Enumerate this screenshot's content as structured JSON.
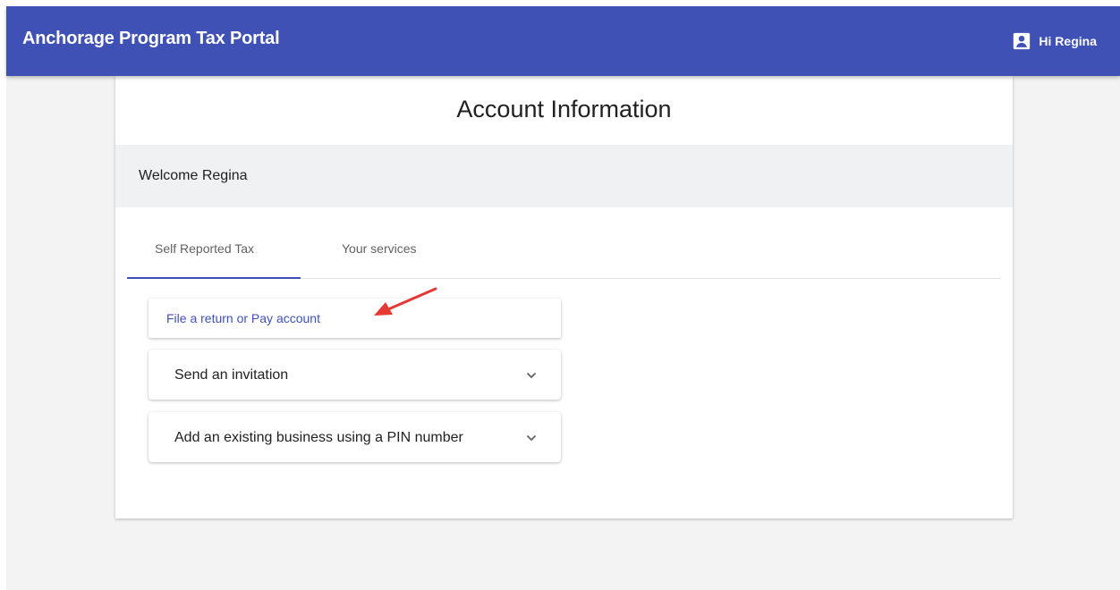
{
  "app_bar": {
    "title": "Anchorage Program Tax Portal",
    "user_greeting": "Hi Regina",
    "user_icon": "account-box-icon",
    "color": "#3f51b5"
  },
  "card": {
    "title": "Account Information",
    "welcome": "Welcome Regina"
  },
  "tabs": [
    {
      "label": "Self Reported Tax",
      "active": true
    },
    {
      "label": "Your services",
      "active": false
    }
  ],
  "actions": {
    "file_link": "File a return or Pay account",
    "panels": [
      {
        "label": "Send an invitation",
        "icon": "chevron-down-icon"
      },
      {
        "label": "Add an existing business using a PIN number",
        "icon": "chevron-down-icon"
      }
    ]
  },
  "annotation": {
    "icon": "red-arrow-icon",
    "color": "#e53935"
  }
}
